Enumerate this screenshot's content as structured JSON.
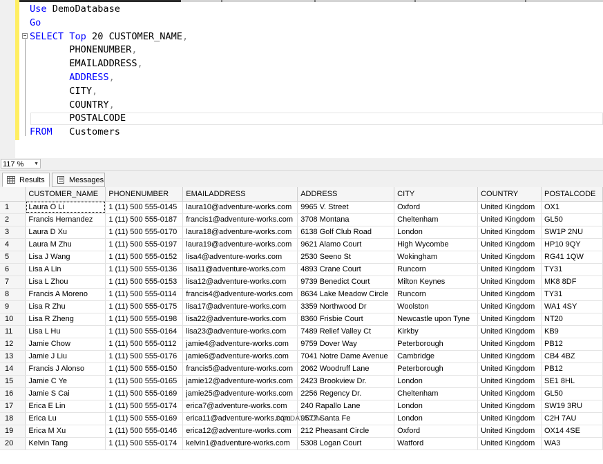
{
  "editor": {
    "lines": [
      [
        {
          "t": "Use",
          "c": "kw"
        },
        {
          "t": " DemoDatabase",
          "c": ""
        }
      ],
      [
        {
          "t": "Go",
          "c": "kw"
        }
      ],
      [
        {
          "t": "SELECT",
          "c": "kw"
        },
        {
          "t": " ",
          "c": ""
        },
        {
          "t": "Top",
          "c": "kw"
        },
        {
          "t": " 20 CUSTOMER_NAME",
          "c": ""
        },
        {
          "t": ",",
          "c": "gray"
        }
      ],
      [
        {
          "t": "       PHONENUMBER",
          "c": ""
        },
        {
          "t": ",",
          "c": "gray"
        }
      ],
      [
        {
          "t": "       EMAILADDRESS",
          "c": ""
        },
        {
          "t": ",",
          "c": "gray"
        }
      ],
      [
        {
          "t": "       ",
          "c": ""
        },
        {
          "t": "ADDRESS",
          "c": "kw"
        },
        {
          "t": ",",
          "c": "gray"
        }
      ],
      [
        {
          "t": "       CITY",
          "c": ""
        },
        {
          "t": ",",
          "c": "gray"
        }
      ],
      [
        {
          "t": "       COUNTRY",
          "c": ""
        },
        {
          "t": ",",
          "c": "gray"
        }
      ],
      [
        {
          "t": "       POSTALCODE",
          "c": ""
        }
      ],
      [
        {
          "t": "FROM",
          "c": "kw"
        },
        {
          "t": "   Customers",
          "c": ""
        }
      ]
    ]
  },
  "zoom": {
    "value": "117 %"
  },
  "tabs": [
    {
      "label": "Results"
    },
    {
      "label": "Messages"
    }
  ],
  "watermark": "SQLDAT.COM",
  "grid": {
    "columns": [
      "CUSTOMER_NAME",
      "PHONENUMBER",
      "EMAILADDRESS",
      "ADDRESS",
      "CITY",
      "COUNTRY",
      "POSTALCODE"
    ],
    "rows": [
      [
        "1",
        "Laura O Li",
        "1 (11) 500 555-0145",
        "laura10@adventure-works.com",
        "9965 V. Street",
        "Oxford",
        "United Kingdom",
        "OX1"
      ],
      [
        "2",
        "Francis  Hernandez",
        "1 (11) 500 555-0187",
        "francis1@adventure-works.com",
        "3708 Montana",
        "Cheltenham",
        "United Kingdom",
        "GL50"
      ],
      [
        "3",
        "Laura D Xu",
        "1 (11) 500 555-0170",
        "laura18@adventure-works.com",
        "6138 Golf Club Road",
        "London",
        "United Kingdom",
        "SW1P 2NU"
      ],
      [
        "4",
        "Laura M Zhu",
        "1 (11) 500 555-0197",
        "laura19@adventure-works.com",
        "9621 Alamo Court",
        "High Wycombe",
        "United Kingdom",
        "HP10 9QY"
      ],
      [
        "5",
        "Lisa J Wang",
        "1 (11) 500 555-0152",
        "lisa4@adventure-works.com",
        "2530 Seeno St",
        "Wokingham",
        "United Kingdom",
        "RG41 1QW"
      ],
      [
        "6",
        "Lisa A Lin",
        "1 (11) 500 555-0136",
        "lisa11@adventure-works.com",
        "4893 Crane Court",
        "Runcorn",
        "United Kingdom",
        "TY31"
      ],
      [
        "7",
        "Lisa L Zhou",
        "1 (11) 500 555-0153",
        "lisa12@adventure-works.com",
        "9739 Benedict Court",
        "Milton Keynes",
        "United Kingdom",
        "MK8 8DF"
      ],
      [
        "8",
        "Francis A Moreno",
        "1 (11) 500 555-0114",
        "francis4@adventure-works.com",
        "8634 Lake Meadow Circle",
        "Runcorn",
        "United Kingdom",
        "TY31"
      ],
      [
        "9",
        "Lisa R Zhu",
        "1 (11) 500 555-0175",
        "lisa17@adventure-works.com",
        "3359 Northwood Dr",
        "Woolston",
        "United Kingdom",
        "WA1 4SY"
      ],
      [
        "10",
        "Lisa R Zheng",
        "1 (11) 500 555-0198",
        "lisa22@adventure-works.com",
        "8360 Frisbie Court",
        "Newcastle upon Tyne",
        "United Kingdom",
        "NT20"
      ],
      [
        "11",
        "Lisa L Hu",
        "1 (11) 500 555-0164",
        "lisa23@adventure-works.com",
        "7489 Relief Valley Ct",
        "Kirkby",
        "United Kingdom",
        "KB9"
      ],
      [
        "12",
        "Jamie  Chow",
        "1 (11) 500 555-0112",
        "jamie4@adventure-works.com",
        "9759 Dover Way",
        "Peterborough",
        "United Kingdom",
        "PB12"
      ],
      [
        "13",
        "Jamie J Liu",
        "1 (11) 500 555-0176",
        "jamie6@adventure-works.com",
        "7041 Notre Dame Avenue",
        "Cambridge",
        "United Kingdom",
        "CB4 4BZ"
      ],
      [
        "14",
        "Francis J Alonso",
        "1 (11) 500 555-0150",
        "francis5@adventure-works.com",
        "2062 Woodruff Lane",
        "Peterborough",
        "United Kingdom",
        "PB12"
      ],
      [
        "15",
        "Jamie C Ye",
        "1 (11) 500 555-0165",
        "jamie12@adventure-works.com",
        "2423 Brookview Dr.",
        "London",
        "United Kingdom",
        "SE1 8HL"
      ],
      [
        "16",
        "Jamie S Cai",
        "1 (11) 500 555-0169",
        "jamie25@adventure-works.com",
        "2256 Regency Dr.",
        "Cheltenham",
        "United Kingdom",
        "GL50"
      ],
      [
        "17",
        "Erica E Lin",
        "1 (11) 500 555-0174",
        "erica7@adventure-works.com",
        "240 Rapallo Lane",
        "London",
        "United Kingdom",
        "SW19 3RU"
      ],
      [
        "18",
        "Erica  Lu",
        "1 (11) 500 555-0169",
        "erica11@adventure-works.com",
        "9577 Santa Fe",
        "London",
        "United Kingdom",
        "C2H 7AU"
      ],
      [
        "19",
        "Erica M Xu",
        "1 (11) 500 555-0146",
        "erica12@adventure-works.com",
        "212 Pheasant Circle",
        "Oxford",
        "United Kingdom",
        "OX14 4SE"
      ],
      [
        "20",
        "Kelvin  Tang",
        "1 (11) 500 555-0174",
        "kelvin1@adventure-works.com",
        "5308 Logan Court",
        "Watford",
        "United Kingdom",
        "WA3"
      ]
    ]
  }
}
